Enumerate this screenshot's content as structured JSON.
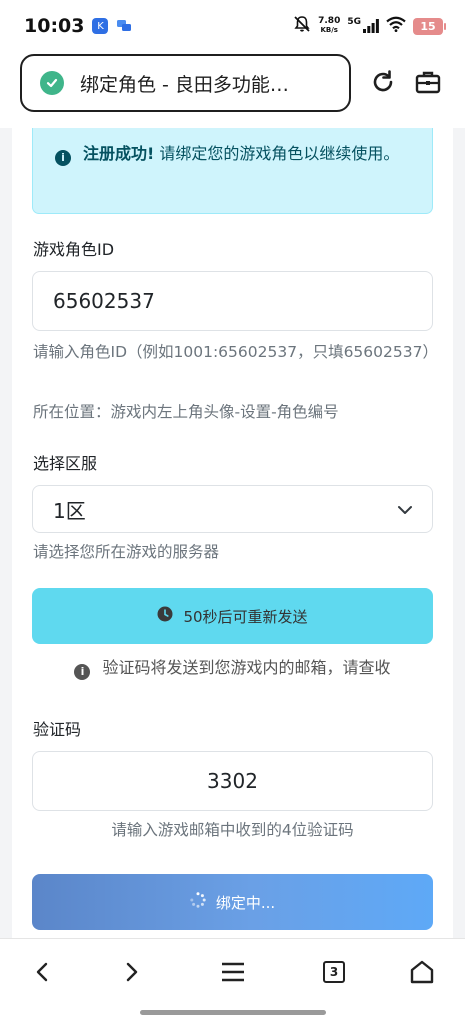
{
  "status": {
    "time": "10:03",
    "net_speed_value": "7.80",
    "net_speed_unit": "KB/s",
    "net_type": "5G",
    "battery": "15"
  },
  "browser": {
    "page_title": "绑定角色 - 良田多功能…",
    "tab_count": "3"
  },
  "alert": {
    "strong": "注册成功!",
    "message": "请绑定您的游戏角色以继续使用。"
  },
  "form": {
    "role_id_label": "游戏角色ID",
    "role_id_value": "65602537",
    "role_id_help": "请输入角色ID（例如1001:65602537，只填65602537）",
    "role_id_location": "所在位置：游戏内左上角头像-设置-角色编号",
    "server_label": "选择区服",
    "server_value": "1区",
    "server_help": "请选择您所在游戏的服务器",
    "resend_label": "50秒后可重新发送",
    "code_note": "验证码将发送到您游戏内的邮箱，请查收",
    "code_label": "验证码",
    "code_value": "3302",
    "code_help": "请输入游戏邮箱中收到的4位验证码",
    "bind_label": "绑定中..."
  },
  "colors": {
    "alert_bg": "#cff4fc",
    "alert_text": "#055160",
    "resend_bg": "#5fd9ef",
    "bind_gradient_start": "#5b86c9",
    "bind_gradient_end": "#5ea9f7",
    "shield": "#3fb58a",
    "battery": "#e58b8b"
  },
  "icons": [
    "shield-check-icon",
    "reload-icon",
    "toolbox-icon",
    "info-icon",
    "clock-icon",
    "spinner-icon",
    "chevron-down-icon",
    "back-icon",
    "forward-icon",
    "menu-icon",
    "home-icon"
  ]
}
